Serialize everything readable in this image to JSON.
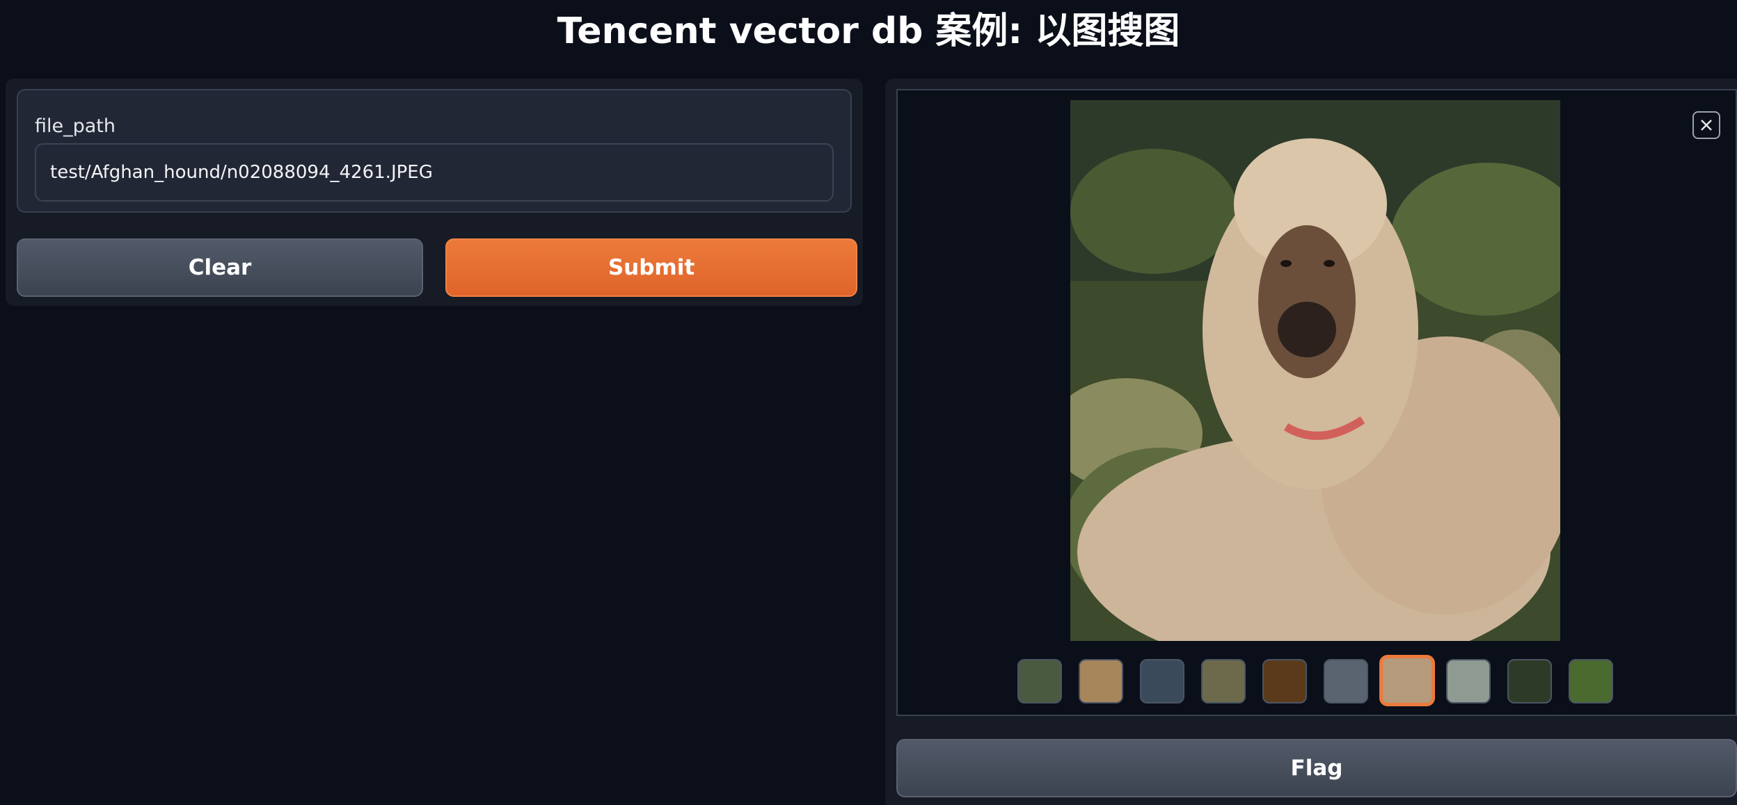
{
  "header": {
    "title": "Tencent vector db 案例: 以图搜图"
  },
  "input": {
    "label": "file_path",
    "value": "test/Afghan_hound/n02088094_4261.JPEG"
  },
  "buttons": {
    "clear": "Clear",
    "submit": "Submit",
    "flag": "Flag"
  },
  "gallery": {
    "selected_index": 6,
    "thumbnails": [
      "thumb-1",
      "thumb-2",
      "thumb-3",
      "thumb-4",
      "thumb-5",
      "thumb-6",
      "thumb-7",
      "thumb-8",
      "thumb-9",
      "thumb-10"
    ]
  },
  "icons": {
    "close": "close-icon"
  },
  "colors": {
    "accent": "#ec7a3a",
    "background": "#0b0f19",
    "panel": "#171b25"
  }
}
